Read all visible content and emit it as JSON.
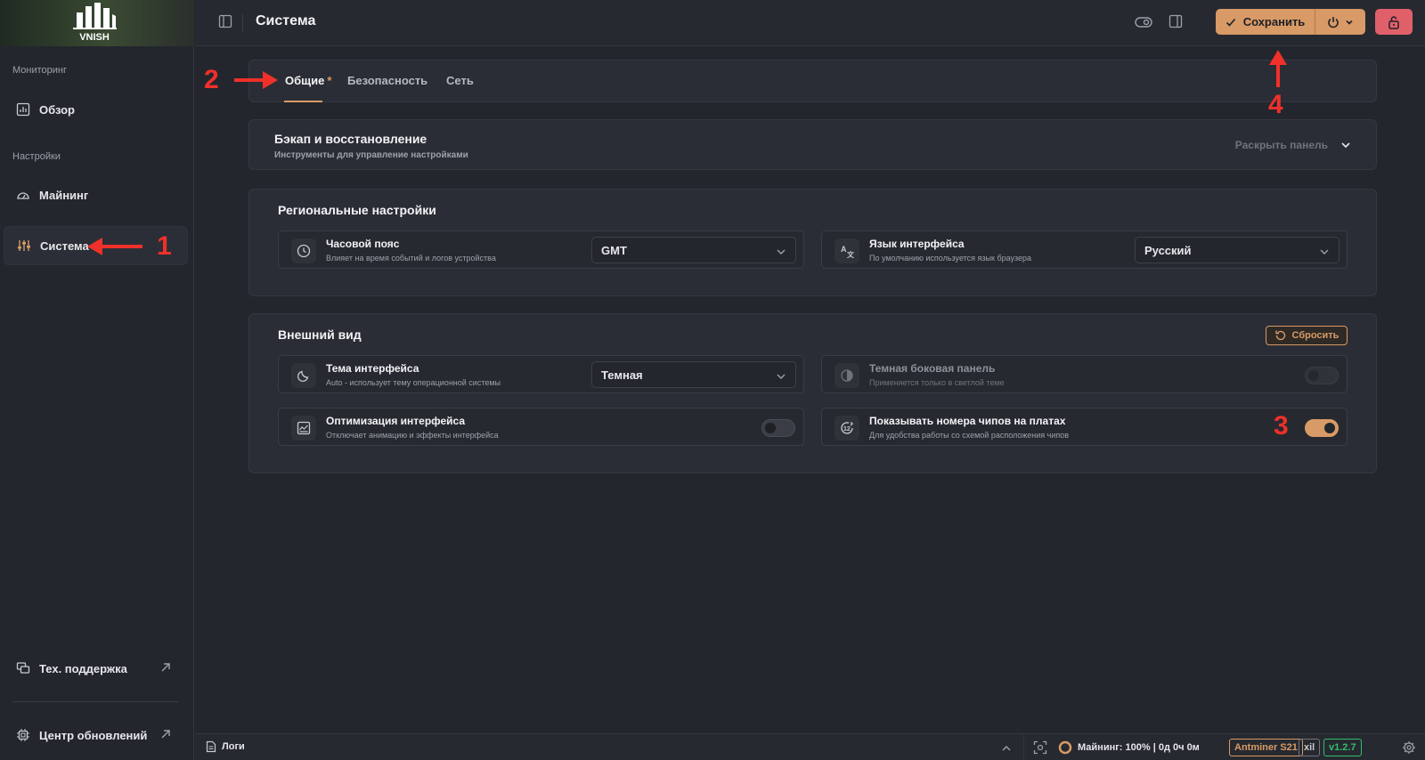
{
  "brand": {
    "logo_text": "VNISH"
  },
  "sidebar": {
    "group_monitoring": "Мониторинг",
    "overview": "Обзор",
    "group_settings": "Настройки",
    "mining": "Майнинг",
    "system": "Система",
    "support": "Тех. поддержка",
    "updates": "Центр обновлений"
  },
  "header": {
    "title": "Система",
    "save_label": "Сохранить"
  },
  "tabs": [
    {
      "label": "Общие",
      "active": true,
      "modified": "*"
    },
    {
      "label": "Безопасность"
    },
    {
      "label": "Сеть"
    }
  ],
  "backup": {
    "title": "Бэкап и восстановление",
    "subtitle": "Инструменты для управление настройками",
    "expand_label": "Раскрыть панель"
  },
  "regional": {
    "title": "Региональные настройки",
    "timezone": {
      "title": "Часовой пояс",
      "desc": "Влияет на время событий и логов устройства",
      "value": "GMT"
    },
    "language": {
      "title": "Язык интерфейса",
      "desc": "По умолчанию используется язык браузера",
      "value": "Русский"
    }
  },
  "appearance": {
    "title": "Внешний вид",
    "reset_label": "Сбросить",
    "theme": {
      "title": "Тема интерфейса",
      "desc": "Auto - использует тему операционной системы",
      "value": "Темная"
    },
    "dark_sidebar": {
      "title": "Темная боковая панель",
      "desc": "Применяется только в светлой теме",
      "enabled": false
    },
    "optimize": {
      "title": "Оптимизация интерфейса",
      "desc": "Отключает анимацию и эффекты интерфейса",
      "enabled": false
    },
    "chip_numbers": {
      "title": "Показывать номера чипов на платах",
      "desc": "Для удобства работы со схемой расположения чипов",
      "enabled": true
    }
  },
  "bottombar": {
    "logs": "Логи",
    "mining_status": "Майнинг: 100% | 0д 0ч 0м",
    "model": "Antminer S21",
    "variant": "xil",
    "version": "v1.2.7"
  },
  "annotations": {
    "a1": "1",
    "a2": "2",
    "a3": "3",
    "a4": "4"
  },
  "colors": {
    "accent": "#d89a66",
    "danger": "#e0606a",
    "annotation": "#f0302a",
    "version_green": "#2fbf6a"
  }
}
